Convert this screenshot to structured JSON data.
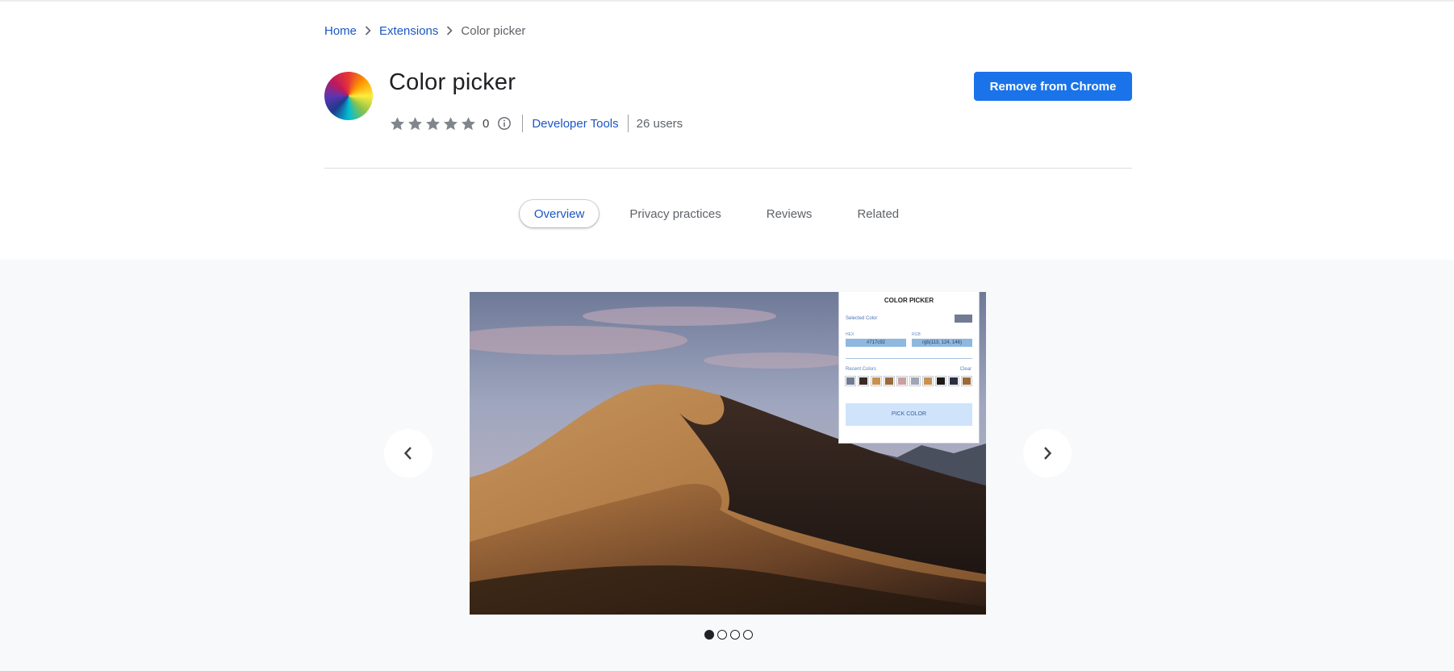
{
  "breadcrumb": {
    "home": "Home",
    "extensions": "Extensions",
    "current": "Color picker"
  },
  "extension": {
    "title": "Color picker",
    "rating_count": "0",
    "category": "Developer Tools",
    "users": "26 users",
    "stars_filled": 0
  },
  "actions": {
    "remove_label": "Remove from Chrome"
  },
  "tabs": [
    {
      "label": "Overview",
      "active": true
    },
    {
      "label": "Privacy practices",
      "active": false
    },
    {
      "label": "Reviews",
      "active": false
    },
    {
      "label": "Related",
      "active": false
    }
  ],
  "screenshot": {
    "panel_title": "COLOR PICKER",
    "selected_label": "Selected Color",
    "selected_color": "#717c92",
    "hex_label": "HEX",
    "rgb_label": "RGB",
    "hex_value": "#717c92",
    "rgb_value": "rgb(113, 124, 146)",
    "recent_label": "Recent Colors",
    "clear_label": "Clear",
    "recent_colors": [
      "#717c92",
      "#3a2a22",
      "#c8914f",
      "#9a6a3a",
      "#c9a0a0",
      "#9ea6b4",
      "#c8914f",
      "#1e1a1a",
      "#2a2e40",
      "#9a6a3a"
    ],
    "pick_label": "PICK COLOR"
  },
  "carousel": {
    "total": 4,
    "active_index": 0
  },
  "colors": {
    "link": "#1a56c4",
    "button": "#1a73e8",
    "gallery_bg": "#f8f9fa"
  }
}
